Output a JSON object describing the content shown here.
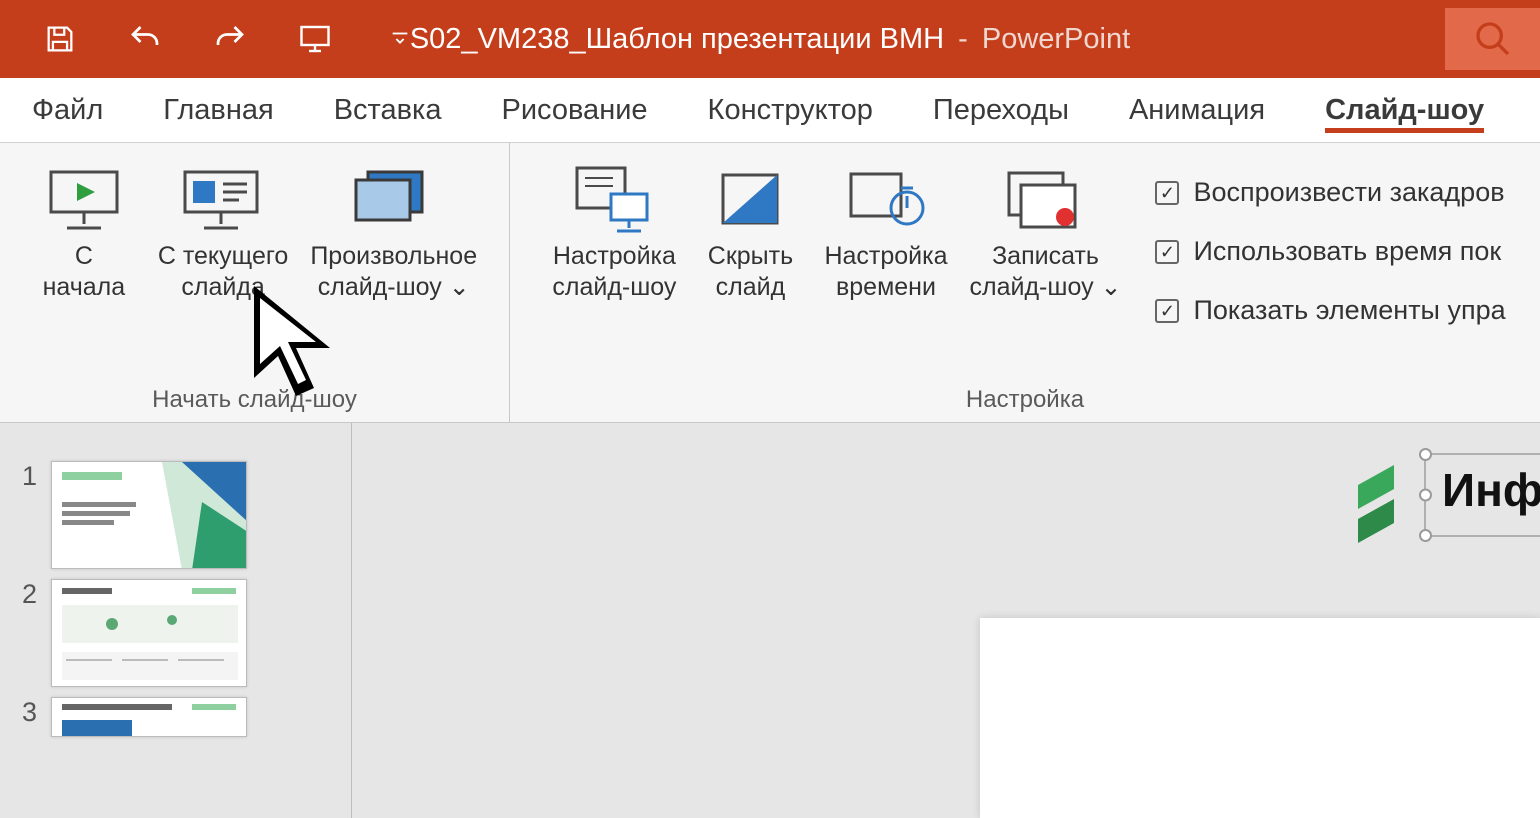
{
  "title": {
    "document_name": "S02_VM238_Шаблон презентации ВМН",
    "separator": "  -  ",
    "app_name": "PowerPoint"
  },
  "qat": {
    "save": "save",
    "undo": "undo",
    "redo": "redo",
    "start": "start-from-beginning",
    "customize": "customize"
  },
  "tabs": {
    "file": "Файл",
    "home": "Главная",
    "insert": "Вставка",
    "draw": "Рисование",
    "design": "Конструктор",
    "transitions": "Переходы",
    "animations": "Анимация",
    "slideshow": "Слайд-шоу"
  },
  "ribbon": {
    "group_start_label": "Начать слайд-шоу",
    "group_settings_label": "Настройка",
    "from_beginning": "С\nначала",
    "from_current": "С текущего\nслайда",
    "custom_show": "Произвольное\nслайд-шоу ⌄",
    "setup_show": "Настройка\nслайд-шоу",
    "hide_slide": "Скрыть\nслайд",
    "rehearse": "Настройка\nвремени",
    "record": "Записать\nслайд-шоу ⌄",
    "checks": {
      "narration": "Воспроизвести закадров",
      "timings": "Использовать время пок",
      "controls": "Показать элементы упра"
    }
  },
  "thumbs": {
    "n1": "1",
    "n2": "2",
    "n3": "3"
  },
  "canvas": {
    "infographic_title": "Инфографика"
  }
}
